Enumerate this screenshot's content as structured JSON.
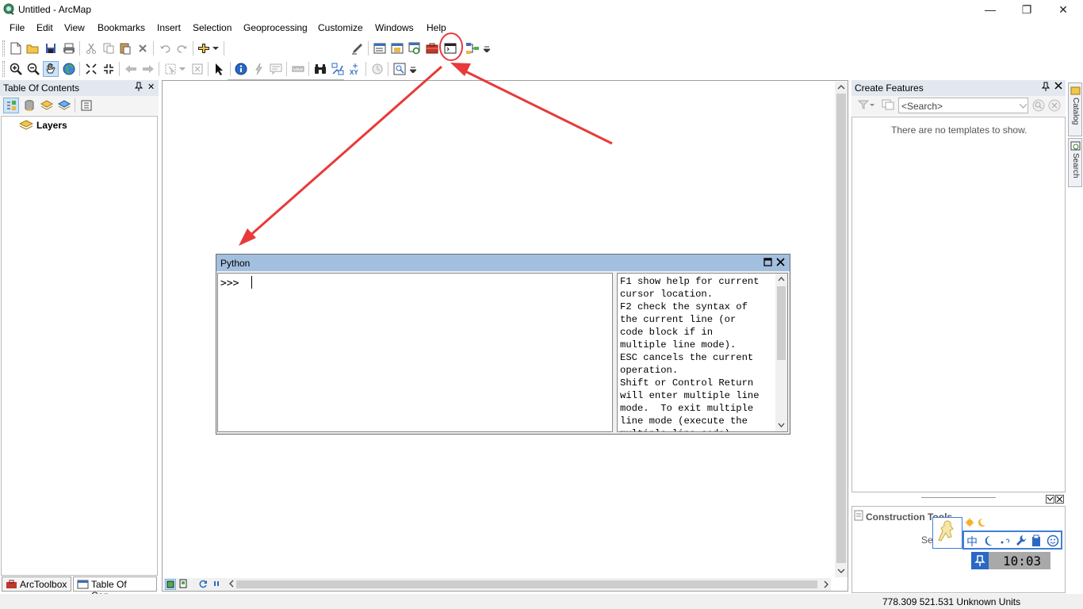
{
  "window": {
    "title": "Untitled - ArcMap",
    "minimize": "—",
    "restore": "❐",
    "close": "✕"
  },
  "menu": [
    "File",
    "Edit",
    "View",
    "Bookmarks",
    "Insert",
    "Selection",
    "Geoprocessing",
    "Customize",
    "Windows",
    "Help"
  ],
  "toc": {
    "title": "Table Of Contents",
    "pin": "📌",
    "close": "✕",
    "root_layer": "Layers"
  },
  "create_features": {
    "title": "Create Features",
    "search_placeholder": "<Search>",
    "empty_message": "There are no templates to show.",
    "construction_tools_label": "Construction Tools",
    "select_partial": "Se"
  },
  "python": {
    "title": "Python",
    "prompt": ">>> ",
    "help_text": "F1 show help for current\ncursor location.\nF2 check the syntax of\nthe current line (or\ncode block if in\nmultiple line mode).\nESC cancels the current\noperation.\nShift or Control Return\nwill enter multiple line\nmode.  To exit multiple\nline mode (execute the\nmultiple line code),"
  },
  "side_tabs": [
    "Catalog",
    "Search"
  ],
  "bottom_tabs": [
    "ArcToolbox",
    "Table Of Con..."
  ],
  "status": {
    "coordinates": "778.309  521.531 Unknown Units"
  },
  "ime": {
    "lang": "中",
    "clock": "10:03"
  },
  "colors": {
    "annotation": "#e83a3a",
    "panel_title": "#e3e8f0",
    "python_title": "#a3bfdf"
  }
}
